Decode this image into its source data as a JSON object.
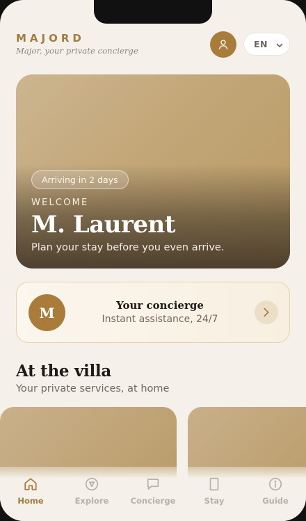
{
  "header": {
    "brand": "MAJORD",
    "tagline": "Major, your private concierge",
    "language": "EN"
  },
  "hero": {
    "badge": "Arriving in 2 days",
    "eyebrow": "WELCOME",
    "guest_name": "M. Laurent",
    "subtitle": "Plan your stay before you even arrive."
  },
  "concierge": {
    "initial": "M",
    "title": "Your concierge",
    "subtitle": "Instant assistance, 24/7"
  },
  "section": {
    "title": "At the villa",
    "subtitle": "Your private services, at home"
  },
  "tabs": [
    {
      "label": "Home",
      "icon": "home-icon",
      "active": true
    },
    {
      "label": "Explore",
      "icon": "compass-icon",
      "active": false
    },
    {
      "label": "Concierge",
      "icon": "chat-icon",
      "active": false
    },
    {
      "label": "Stay",
      "icon": "door-icon",
      "active": false
    },
    {
      "label": "Guide",
      "icon": "info-icon",
      "active": false
    }
  ],
  "colors": {
    "accent": "#a97c3c",
    "background": "#f5f1ea",
    "inactive": "#b7b1a8"
  }
}
